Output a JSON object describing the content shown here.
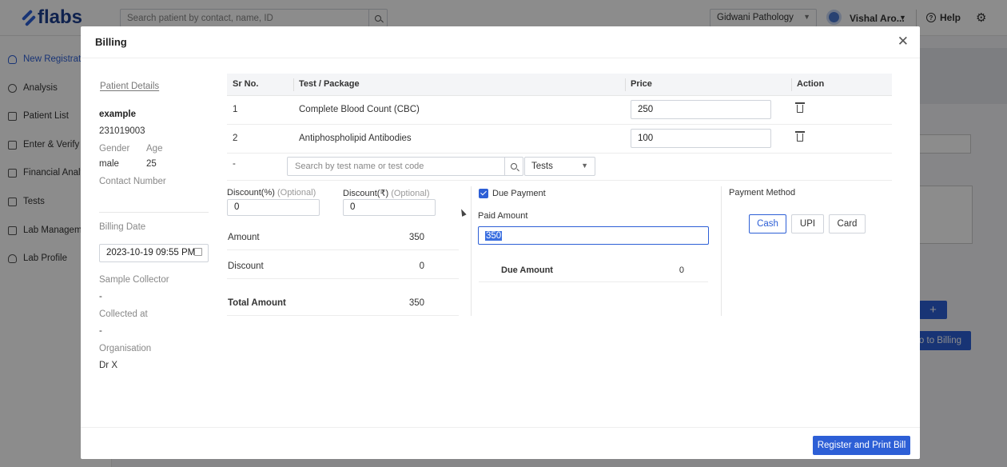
{
  "app": {
    "logo_text": "flabs",
    "search_placeholder": "Search patient by contact, name, ID",
    "lab_name": "Gidwani Pathology",
    "user_name": "Vishal Aro...",
    "help_label": "Help"
  },
  "sidebar": {
    "items": [
      {
        "label": "New Registration",
        "icon": "user-icon"
      },
      {
        "label": "Analysis",
        "icon": "gauge-icon"
      },
      {
        "label": "Patient List",
        "icon": "list-icon"
      },
      {
        "label": "Enter & Verify",
        "icon": "table-icon"
      },
      {
        "label": "Financial Analysis",
        "icon": "chart-icon"
      },
      {
        "label": "Tests",
        "icon": "tests-icon"
      },
      {
        "label": "Lab Management",
        "icon": "lab-icon"
      },
      {
        "label": "Lab Profile",
        "icon": "profile-icon"
      }
    ]
  },
  "background": {
    "go_to_billing": "Go to Billing",
    "plus": "+"
  },
  "modal": {
    "title": "Billing",
    "register_button": "Register and Print Bill"
  },
  "patient": {
    "section_title": "Patient Details",
    "name": "example",
    "id": "231019003",
    "gender_label": "Gender",
    "gender": "male",
    "age_label": "Age",
    "age": "25",
    "contact_label": "Contact Number",
    "billing_date_label": "Billing Date",
    "billing_date": "2023-10-19 09:55 PM",
    "sample_collector_label": "Sample Collector",
    "sample_collector": "-",
    "collected_at_label": "Collected at",
    "collected_at": "-",
    "organisation_label": "Organisation",
    "organisation": "Dr X"
  },
  "tests": {
    "headers": {
      "sr": "Sr No.",
      "name": "Test / Package",
      "price": "Price",
      "action": "Action"
    },
    "rows": [
      {
        "sr": "1",
        "name": "Complete Blood Count (CBC)",
        "price": "250"
      },
      {
        "sr": "2",
        "name": "Antiphospholipid Antibodies",
        "price": "100"
      }
    ],
    "new_row_sr": "-",
    "search_placeholder": "Search by test name or test code",
    "type_selected": "Tests"
  },
  "discount": {
    "percent_label": "Discount(%)",
    "rupee_label": "Discount(₹)",
    "optional": "(Optional)",
    "percent_value": "0",
    "rupee_value": "0"
  },
  "summary": {
    "amount_label": "Amount",
    "amount": "350",
    "discount_label": "Discount",
    "discount": "0",
    "total_label": "Total Amount",
    "total": "350"
  },
  "payment": {
    "due_payment_label": "Due Payment",
    "due_payment_checked": true,
    "paid_amount_label": "Paid Amount",
    "paid_amount": "350",
    "due_amount_label": "Due Amount",
    "due_amount": "0",
    "method_label": "Payment Method",
    "methods": [
      "Cash",
      "UPI",
      "Card"
    ],
    "selected_method": "Cash"
  },
  "colors": {
    "accent": "#2d5fd6",
    "brand": "#1d3e8f"
  }
}
